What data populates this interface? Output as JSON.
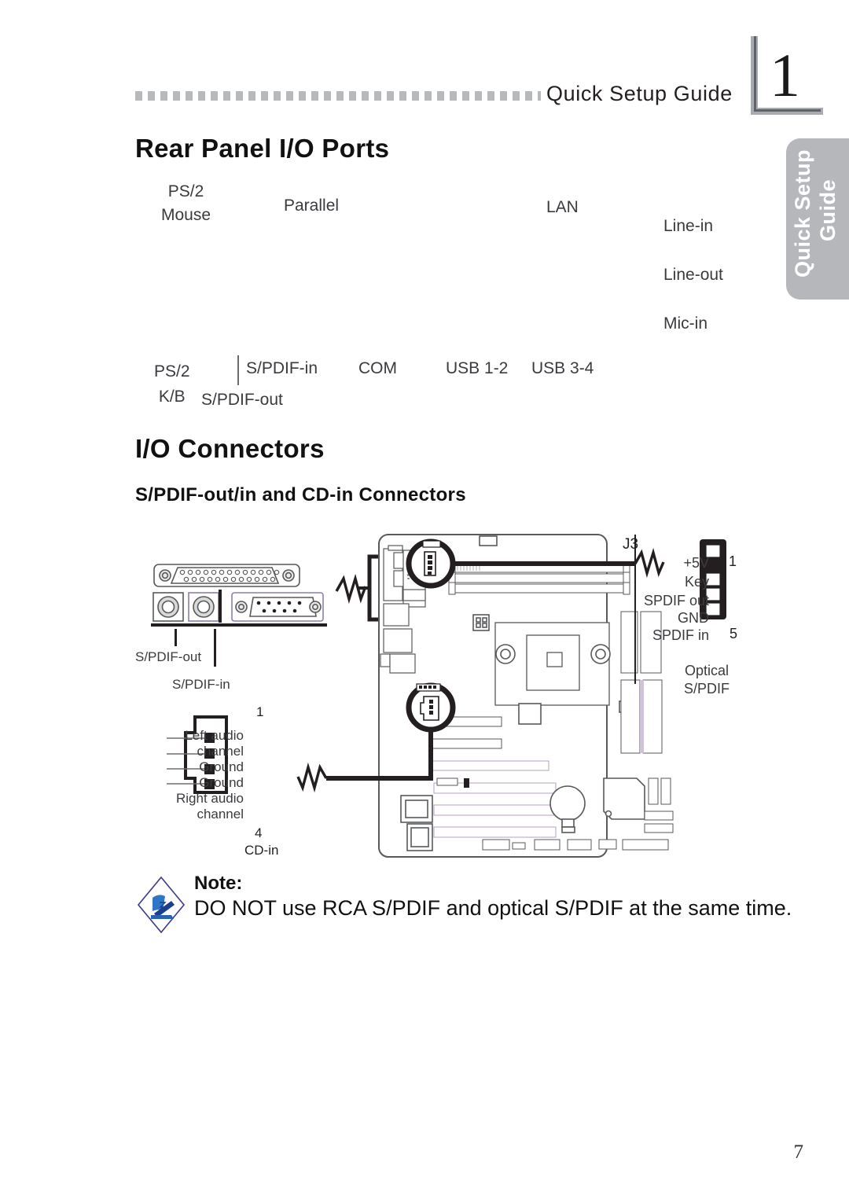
{
  "header": {
    "title": "Quick Setup Guide",
    "chapter_number": "1",
    "side_tab_line1": "Quick Setup",
    "side_tab_line2": "Guide"
  },
  "headings": {
    "rear_panel": "Rear Panel I/O Ports",
    "io_connectors": "I/O Connectors",
    "spdif_cdin": "S/PDIF-out/in and CD-in Connectors"
  },
  "rear_panel_labels": {
    "ps2_mouse": "PS/2\nMouse",
    "ps2_mouse_l1": "PS/2",
    "ps2_mouse_l2": "Mouse",
    "parallel": "Parallel",
    "lan": "LAN",
    "line_in": "Line-in",
    "line_out": "Line-out",
    "mic_in": "Mic-in",
    "ps2_kb_l1": "PS/2",
    "ps2_kb_l2": "K/B",
    "spdif_in": "S/PDIF-in",
    "spdif_out": "S/PDIF-out",
    "com": "COM",
    "usb_1_2": "USB 1-2",
    "usb_3_4": "USB 3-4"
  },
  "figure": {
    "spdif_out_callout": "S/PDIF-out",
    "spdif_in_callout": "S/PDIF-in",
    "cd_in": {
      "name": "CD-in",
      "pin_first": "1",
      "pin_last": "4",
      "pins": [
        "Left  audio",
        "channel",
        "Ground",
        "Ground",
        "Right  audio",
        "channel"
      ],
      "signals": [
        "Left audio channel",
        "Ground",
        "Ground",
        "Right audio channel"
      ]
    },
    "j3": {
      "name": "J3",
      "pin_first": "1",
      "pin_last": "5",
      "caption_line1": "Optical",
      "caption_line2": "S/PDIF",
      "pins": [
        "+5V",
        "Key",
        "SPDIF out",
        "GND",
        "SPDIF in"
      ]
    }
  },
  "note": {
    "label": "Note:",
    "text": "DO NOT use RCA S/PDIF and optical S/PDIF at the same time.",
    "icon": "note-diamond-icon"
  },
  "footer": {
    "page_number": "7"
  },
  "colors": {
    "tab_gray": "#b5b7ba",
    "rule_gray": "#b7b9bd",
    "chapter_gray": "#a8abaf",
    "text": "#231f20",
    "note_blue": "#2b62b0",
    "board_line": "#58595b"
  }
}
